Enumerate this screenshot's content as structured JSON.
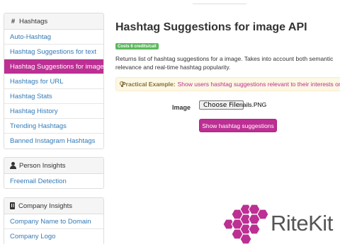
{
  "sidebar": {
    "hashtags": {
      "heading": "Hashtags",
      "items": [
        {
          "label": "Auto-Hashtag"
        },
        {
          "label": "Hashtag Suggestions for text"
        },
        {
          "label": "Hashtag Suggestions for image",
          "active": true
        },
        {
          "label": "Hashtags for URL"
        },
        {
          "label": "Hashtag Stats"
        },
        {
          "label": "Hashtag History"
        },
        {
          "label": "Trending Hashtags"
        },
        {
          "label": "Banned Instagram Hashtags"
        }
      ]
    },
    "person": {
      "heading": "Person Insights",
      "items": [
        {
          "label": "Freemail Detection"
        }
      ]
    },
    "company": {
      "heading": "Company Insights",
      "items": [
        {
          "label": "Company Name to Domain"
        },
        {
          "label": "Company Logo"
        }
      ]
    }
  },
  "main": {
    "title": "Hashtag Suggestions for image API",
    "badge": "Costs 6 credits/call",
    "description": "Returns list of hashtag suggestions for a image. Takes into account both semantic relevance and real-time hashtag popularity.",
    "example": {
      "label": "Practical Example:",
      "text": "Show users hashtag suggestions relevant to their interests or products."
    },
    "form": {
      "image_label": "Image",
      "file_button": "Choose File",
      "file_name": "nails.PNG",
      "submit": "Show hashtag suggestions"
    }
  },
  "logo": {
    "text": "RiteKit",
    "icon": "hexagon-cluster-logo"
  },
  "colors": {
    "brand": "#bc2f93",
    "link": "#337ab7",
    "badge": "#5cb85c",
    "example_bg": "#fcf8e3"
  }
}
